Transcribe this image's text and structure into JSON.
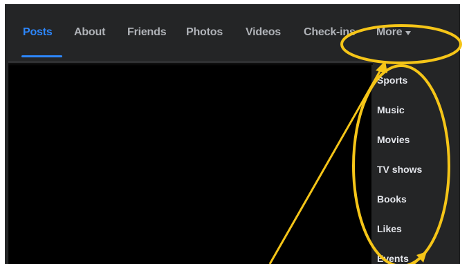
{
  "tabs": [
    {
      "label": "Posts",
      "active": true
    },
    {
      "label": "About"
    },
    {
      "label": "Friends"
    },
    {
      "label": "Photos"
    },
    {
      "label": "Videos"
    },
    {
      "label": "Check-ins"
    },
    {
      "label": "More"
    }
  ],
  "dropdown": {
    "items": [
      "Sports",
      "Music",
      "Movies",
      "TV shows",
      "Books",
      "Likes",
      "Events"
    ]
  },
  "colors": {
    "active_tab": "#2d88ff",
    "tab_text": "#b0b3b8",
    "menu_text": "#e4e6eb",
    "background": "#242526",
    "annotation": "#f5c518"
  },
  "icons": {
    "more_caret": "caret-down-icon"
  }
}
